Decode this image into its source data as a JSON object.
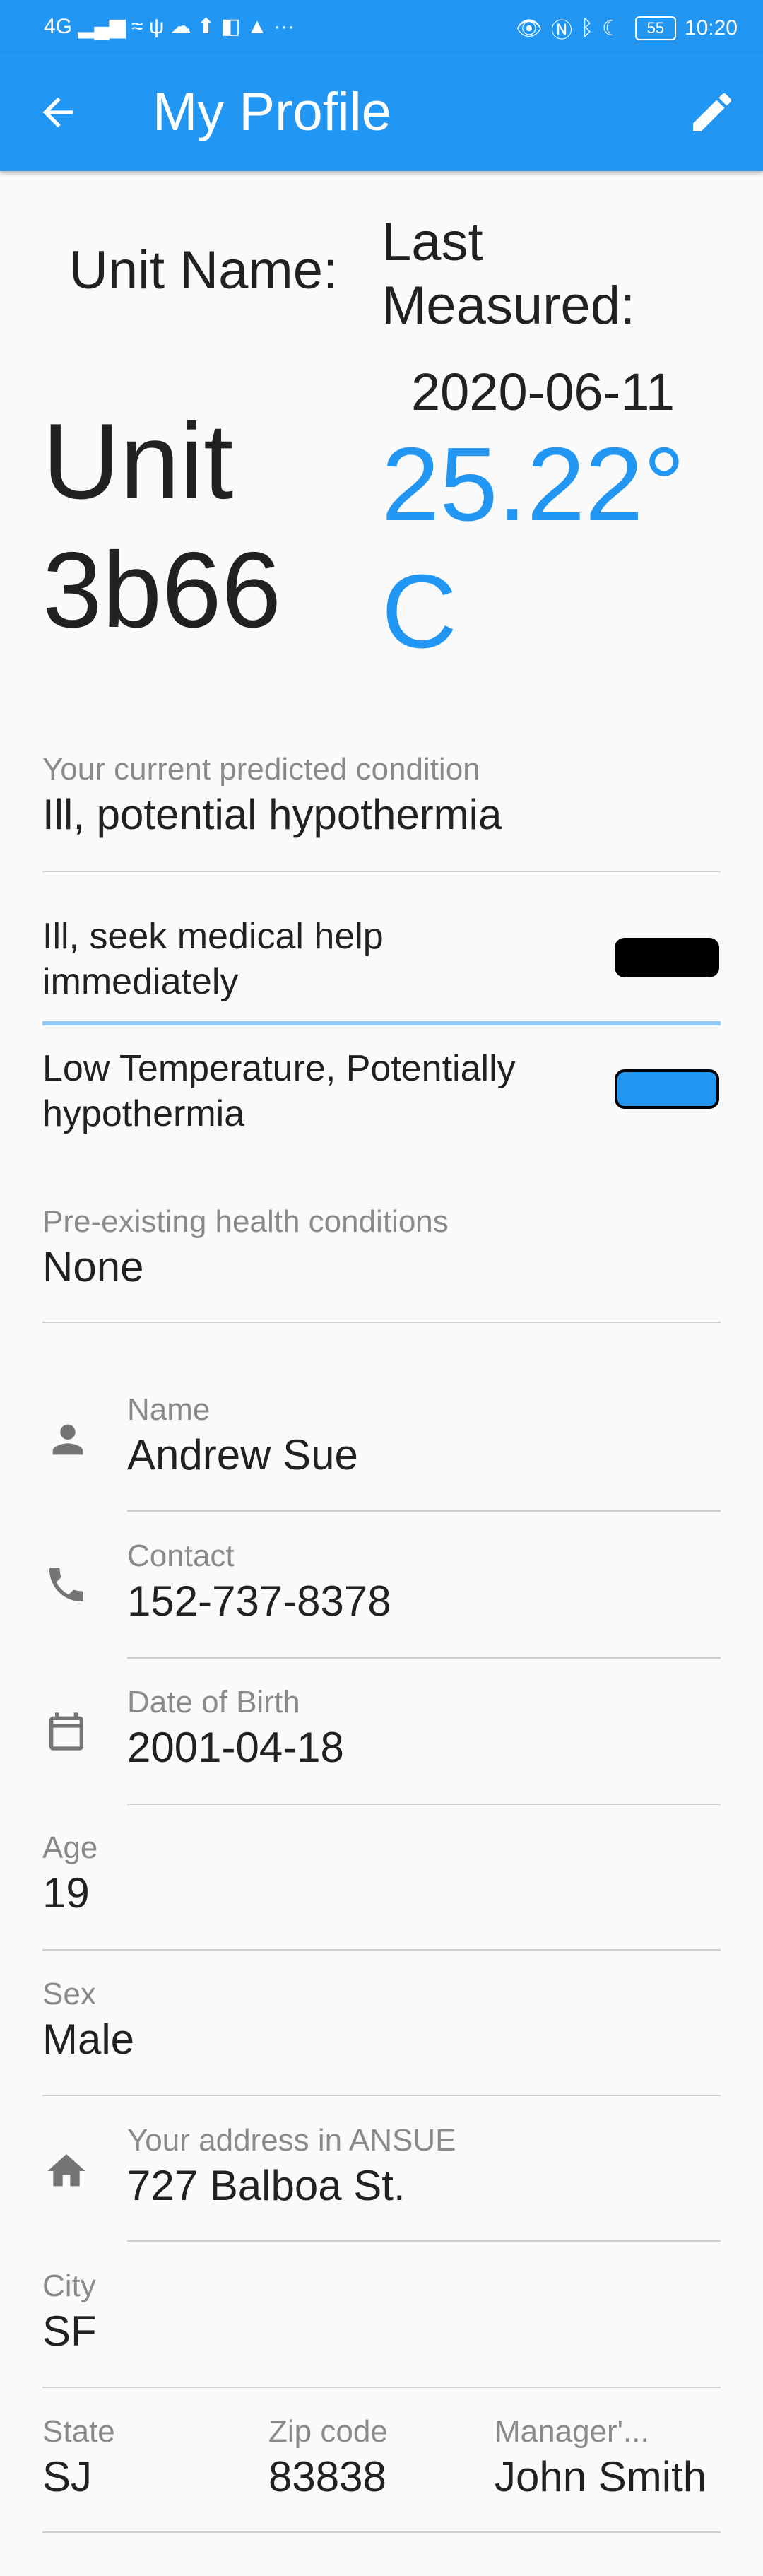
{
  "statusbar": {
    "left": "4G ▂▄▆ ≈ ψ ☁ ⬆ ◧ ▲ ···",
    "battery": "55",
    "time": "10:20"
  },
  "appbar": {
    "title": "My Profile"
  },
  "header": {
    "unit_name_label": "Unit Name:",
    "unit_name_value": "Unit 3b66",
    "last_measured_label": "Last Measured:",
    "measured_date": "2020-06-11",
    "temperature": "25.22° C"
  },
  "condition": {
    "label": "Your current predicted condition",
    "value": "Ill, potential hypothermia"
  },
  "status_rows": [
    {
      "text": "Ill, seek medical help immediately",
      "color": "#000000"
    },
    {
      "text": "Low Temperature, Potentially hypothermia",
      "color": "#2196f3"
    }
  ],
  "preexisting": {
    "label": "Pre-existing health conditions",
    "value": "None"
  },
  "name": {
    "label": "Name",
    "value": "Andrew Sue",
    "icon": "person-icon"
  },
  "contact": {
    "label": "Contact",
    "value": "152-737-8378",
    "icon": "phone-icon"
  },
  "dob": {
    "label": "Date of Birth",
    "value": "2001-04-18",
    "icon": "calendar-icon"
  },
  "age": {
    "label": "Age",
    "value": "19"
  },
  "sex": {
    "label": "Sex",
    "value": "Male"
  },
  "address": {
    "label": "Your address in ANSUE",
    "value": "727 Balboa St.",
    "icon": "home-icon"
  },
  "city": {
    "label": "City",
    "value": "SF"
  },
  "state": {
    "label": "State",
    "value": "SJ"
  },
  "zip": {
    "label": "Zip code",
    "value": "83838"
  },
  "manager": {
    "label": "Manager'...",
    "value": "John Smith"
  },
  "colors": {
    "primary": "#2196f3",
    "text": "#212121",
    "label": "#8a8a8a",
    "divider": "#cfcfcf"
  }
}
